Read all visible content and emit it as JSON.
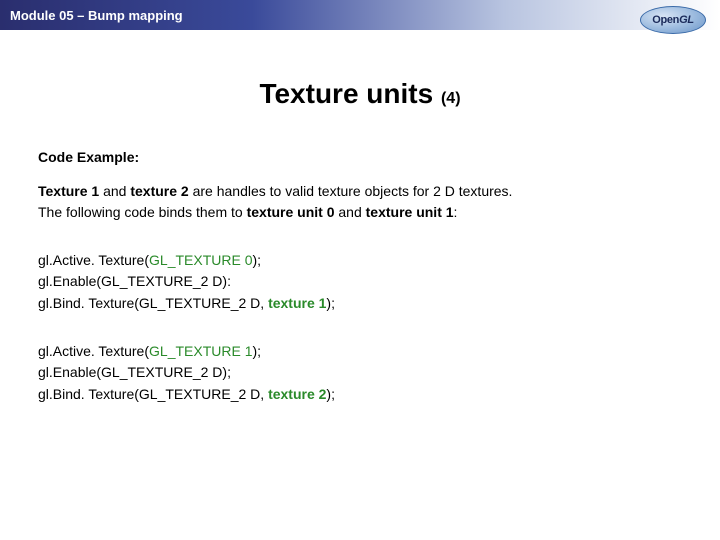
{
  "header": {
    "module_title": "Module 05 – Bump mapping"
  },
  "logo": {
    "open": "Open",
    "gl": "GL"
  },
  "title": {
    "main": "Texture units ",
    "sub": "(4)"
  },
  "body": {
    "code_example_label": "Code Example:",
    "intro": {
      "l1a": "Texture 1",
      "l1b": " and ",
      "l1c": "texture 2",
      "l1d": " are handles to valid texture objects for 2 D textures.",
      "l2a": "The following code binds them to ",
      "l2b": "texture unit 0",
      "l2c": " and ",
      "l2d": "texture unit 1",
      "l2e": ":"
    },
    "block1": {
      "l1a": "gl.Active. Texture(",
      "l1b": "GL_TEXTURE 0",
      "l1c": ");",
      "l2": "gl.Enable(GL_TEXTURE_2 D):",
      "l3a": "gl.Bind. Texture(GL_TEXTURE_2 D, ",
      "l3b": "texture 1",
      "l3c": ");"
    },
    "block2": {
      "l1a": "gl.Active. Texture(",
      "l1b": "GL_TEXTURE 1",
      "l1c": ");",
      "l2": "gl.Enable(GL_TEXTURE_2 D);",
      "l3a": "gl.Bind. Texture(GL_TEXTURE_2 D, ",
      "l3b": "texture 2",
      "l3c": ");"
    }
  }
}
